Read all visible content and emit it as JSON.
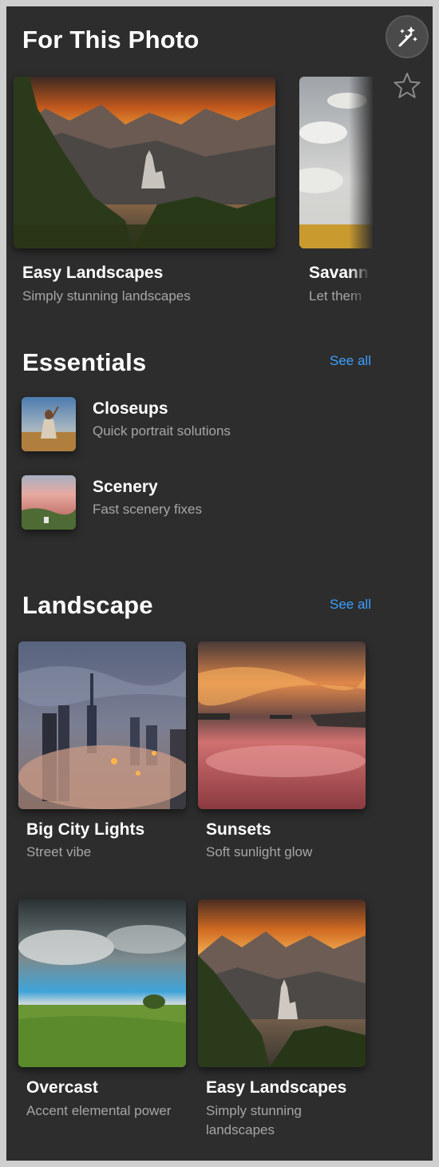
{
  "for_this_photo": {
    "heading": "For This Photo",
    "cards": [
      {
        "title": "Easy Landscapes",
        "subtitle": "Simply stunning landscapes"
      },
      {
        "title": "Savanna",
        "subtitle": "Let them"
      }
    ]
  },
  "essentials": {
    "heading": "Essentials",
    "see_all": "See all",
    "items": [
      {
        "title": "Closeups",
        "subtitle": "Quick portrait solutions"
      },
      {
        "title": "Scenery",
        "subtitle": "Fast scenery fixes"
      }
    ]
  },
  "landscape": {
    "heading": "Landscape",
    "see_all": "See all",
    "cards": [
      {
        "title": "Big City Lights",
        "subtitle": "Street vibe"
      },
      {
        "title": "Sunsets",
        "subtitle": "Soft sunlight glow"
      },
      {
        "title": "Overcast",
        "subtitle": "Accent elemental power"
      },
      {
        "title": "Easy Landscapes",
        "subtitle": "Simply stunning landscapes"
      }
    ]
  },
  "icons": {
    "magic": "magic-wand-icon",
    "favorite": "star-icon"
  },
  "colors": {
    "panel_bg": "#2d2d2d",
    "accent": "#3aa0ff",
    "subtitle": "#a6a6a6"
  }
}
